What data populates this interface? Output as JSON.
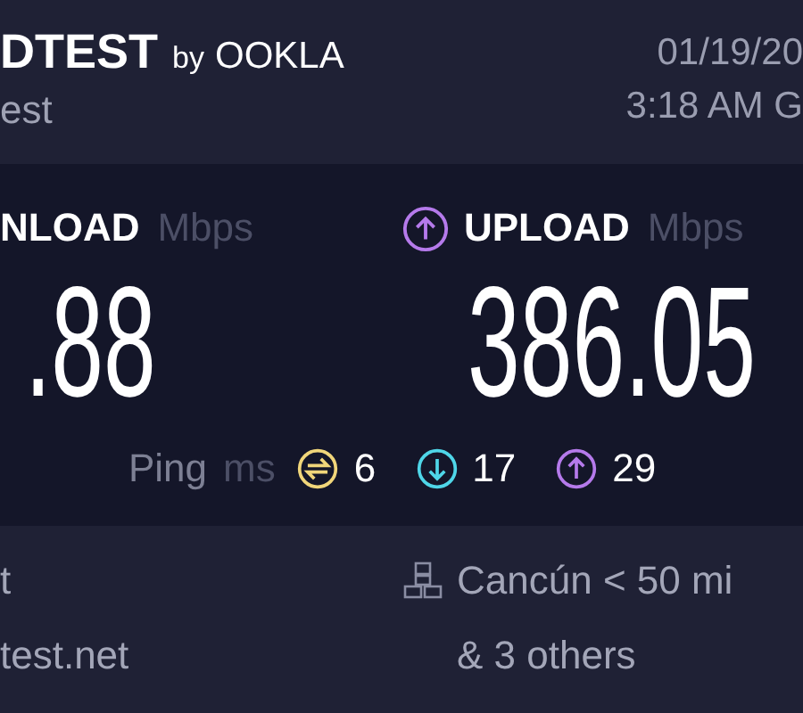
{
  "header": {
    "brand": "DTEST",
    "brand_by": "by",
    "brand_company": "OOKLA",
    "subtitle": "est",
    "date": "01/19/20",
    "time": "3:18 AM G"
  },
  "results": [
    {
      "kind": "download",
      "label": "NLOAD",
      "unit": "Mbps",
      "value": ".88"
    },
    {
      "kind": "upload",
      "label": "UPLOAD",
      "unit": "Mbps",
      "value": "386.05",
      "color": "#b57aeb"
    }
  ],
  "ping": {
    "label": "Ping",
    "unit": "ms",
    "readings": [
      {
        "kind": "idle",
        "value": "6",
        "color": "#f1d67a"
      },
      {
        "kind": "download",
        "value": "17",
        "color": "#4fd6e8"
      },
      {
        "kind": "upload",
        "value": "29",
        "color": "#b57aeb"
      }
    ]
  },
  "provider": {
    "name": "t",
    "host": "test.net"
  },
  "server": {
    "location": "Cancún < 50 mi",
    "others": "& 3 others"
  }
}
